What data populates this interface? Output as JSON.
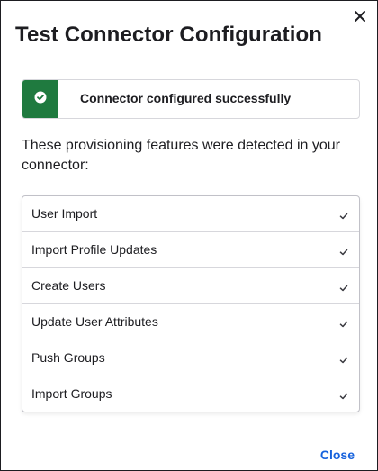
{
  "dialog": {
    "title": "Test Connector Configuration",
    "banner_text": "Connector configured successfully",
    "description": "These provisioning features were detected in your connector:",
    "close_label": "Close"
  },
  "features": [
    {
      "label": "User Import"
    },
    {
      "label": "Import Profile Updates"
    },
    {
      "label": "Create Users"
    },
    {
      "label": "Update User Attributes"
    },
    {
      "label": "Push Groups"
    },
    {
      "label": "Import Groups"
    }
  ],
  "icons": {
    "close": "close-icon",
    "success": "check-circle-icon",
    "feature_check": "check-icon"
  },
  "colors": {
    "success": "#1f7a3f",
    "link": "#1662dd"
  }
}
